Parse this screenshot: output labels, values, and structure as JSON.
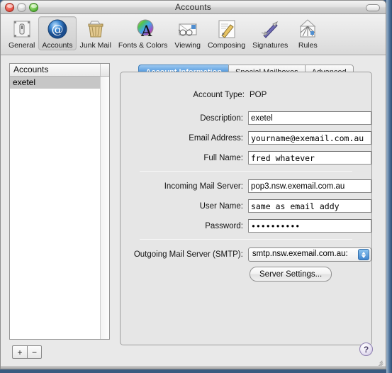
{
  "window": {
    "title": "Accounts",
    "controls": {
      "close": "close-button",
      "minimize": "minimize-button",
      "zoom": "zoom-button"
    },
    "toolbar_toggle": "toolbar-toggle-button"
  },
  "toolbar": {
    "items": [
      {
        "label": "General",
        "icon": "general-icon",
        "selected": false
      },
      {
        "label": "Accounts",
        "icon": "accounts-at-icon",
        "selected": true
      },
      {
        "label": "Junk Mail",
        "icon": "junk-mail-icon",
        "selected": false
      },
      {
        "label": "Fonts & Colors",
        "icon": "fonts-colors-icon",
        "selected": false
      },
      {
        "label": "Viewing",
        "icon": "viewing-icon",
        "selected": false
      },
      {
        "label": "Composing",
        "icon": "composing-icon",
        "selected": false
      },
      {
        "label": "Signatures",
        "icon": "signatures-icon",
        "selected": false
      },
      {
        "label": "Rules",
        "icon": "rules-icon",
        "selected": false
      }
    ]
  },
  "sidebar": {
    "header": "Accounts",
    "accounts": [
      {
        "name": "exetel",
        "selected": true
      }
    ],
    "add_label": "+",
    "remove_label": "−"
  },
  "tabs": [
    {
      "label": "Account Information",
      "active": true
    },
    {
      "label": "Special Mailboxes",
      "active": false
    },
    {
      "label": "Advanced",
      "active": false
    }
  ],
  "form": {
    "account_type_label": "Account Type:",
    "account_type_value": "POP",
    "description_label": "Description:",
    "description_value": "exetel",
    "email_label": "Email Address:",
    "email_value": "yourname@exemail.com.au",
    "fullname_label": "Full Name:",
    "fullname_value": "fred whatever",
    "incoming_label": "Incoming Mail Server:",
    "incoming_value": "pop3.nsw.exemail.com.au",
    "username_label": "User Name:",
    "username_value": "same as email addy",
    "password_label": "Password:",
    "password_value": "••••••••••",
    "smtp_label": "Outgoing Mail Server (SMTP):",
    "smtp_value": "smtp.nsw.exemail.com.au:",
    "server_settings_label": "Server Settings..."
  },
  "footer": {
    "help_label": "?"
  },
  "colors": {
    "tab_active": "#3f8bd6",
    "selection_gray": "#c6c6c6",
    "help_purple": "#8d7fb0",
    "stepper_blue": "#3f86cf"
  }
}
